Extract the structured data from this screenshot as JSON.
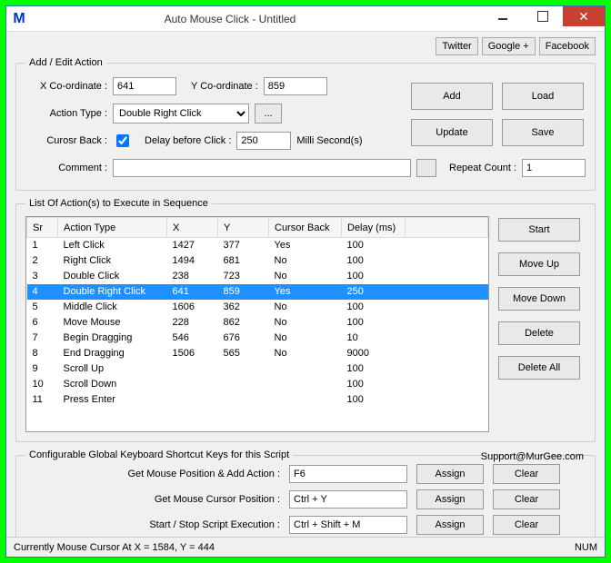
{
  "window": {
    "title": "Auto Mouse Click - Untitled"
  },
  "links": {
    "twitter": "Twitter",
    "google": "Google +",
    "facebook": "Facebook"
  },
  "group_edit": {
    "legend": "Add / Edit Action",
    "xcoord_label": "X Co-ordinate :",
    "xcoord_value": "641",
    "ycoord_label": "Y Co-ordinate :",
    "ycoord_value": "859",
    "actiontype_label": "Action Type :",
    "actiontype_value": "Double Right Click",
    "cursorback_label": "Curosr Back :",
    "delay_label": "Delay before Click :",
    "delay_value": "250",
    "delay_units": "Milli Second(s)",
    "comment_label": "Comment :",
    "comment_value": "",
    "repeat_label": "Repeat Count :",
    "repeat_value": "1",
    "ellipsis": "...",
    "add": "Add",
    "load": "Load",
    "update": "Update",
    "save": "Save"
  },
  "group_list": {
    "legend": "List Of Action(s) to Execute in Sequence",
    "headers": {
      "sr": "Sr",
      "type": "Action Type",
      "x": "X",
      "y": "Y",
      "cb": "Cursor Back",
      "delay": "Delay (ms)"
    },
    "rows": [
      {
        "sr": "1",
        "type": "Left Click",
        "x": "1427",
        "y": "377",
        "cb": "Yes",
        "delay": "100",
        "sel": false
      },
      {
        "sr": "2",
        "type": "Right Click",
        "x": "1494",
        "y": "681",
        "cb": "No",
        "delay": "100",
        "sel": false
      },
      {
        "sr": "3",
        "type": "Double Click",
        "x": "238",
        "y": "723",
        "cb": "No",
        "delay": "100",
        "sel": false
      },
      {
        "sr": "4",
        "type": "Double Right Click",
        "x": "641",
        "y": "859",
        "cb": "Yes",
        "delay": "250",
        "sel": true
      },
      {
        "sr": "5",
        "type": "Middle Click",
        "x": "1606",
        "y": "362",
        "cb": "No",
        "delay": "100",
        "sel": false
      },
      {
        "sr": "6",
        "type": "Move Mouse",
        "x": "228",
        "y": "862",
        "cb": "No",
        "delay": "100",
        "sel": false
      },
      {
        "sr": "7",
        "type": "Begin Dragging",
        "x": "546",
        "y": "676",
        "cb": "No",
        "delay": "10",
        "sel": false
      },
      {
        "sr": "8",
        "type": "End Dragging",
        "x": "1506",
        "y": "565",
        "cb": "No",
        "delay": "9000",
        "sel": false
      },
      {
        "sr": "9",
        "type": "Scroll Up",
        "x": "",
        "y": "",
        "cb": "",
        "delay": "100",
        "sel": false
      },
      {
        "sr": "10",
        "type": "Scroll Down",
        "x": "",
        "y": "",
        "cb": "",
        "delay": "100",
        "sel": false
      },
      {
        "sr": "11",
        "type": "Press Enter",
        "x": "",
        "y": "",
        "cb": "",
        "delay": "100",
        "sel": false
      }
    ],
    "start": "Start",
    "moveup": "Move Up",
    "movedown": "Move Down",
    "delete": "Delete",
    "deleteall": "Delete All"
  },
  "group_sc": {
    "legend": "Configurable Global Keyboard Shortcut Keys for this Script",
    "support": "Support@MurGee.com",
    "r1_label": "Get Mouse Position & Add Action :",
    "r1_value": "F6",
    "r2_label": "Get Mouse Cursor Position :",
    "r2_value": "Ctrl + Y",
    "r3_label": "Start / Stop Script Execution :",
    "r3_value": "Ctrl + Shift + M",
    "assign": "Assign",
    "clear": "Clear"
  },
  "status": {
    "text": "Currently Mouse Cursor At X = 1584, Y = 444",
    "num": "NUM"
  }
}
